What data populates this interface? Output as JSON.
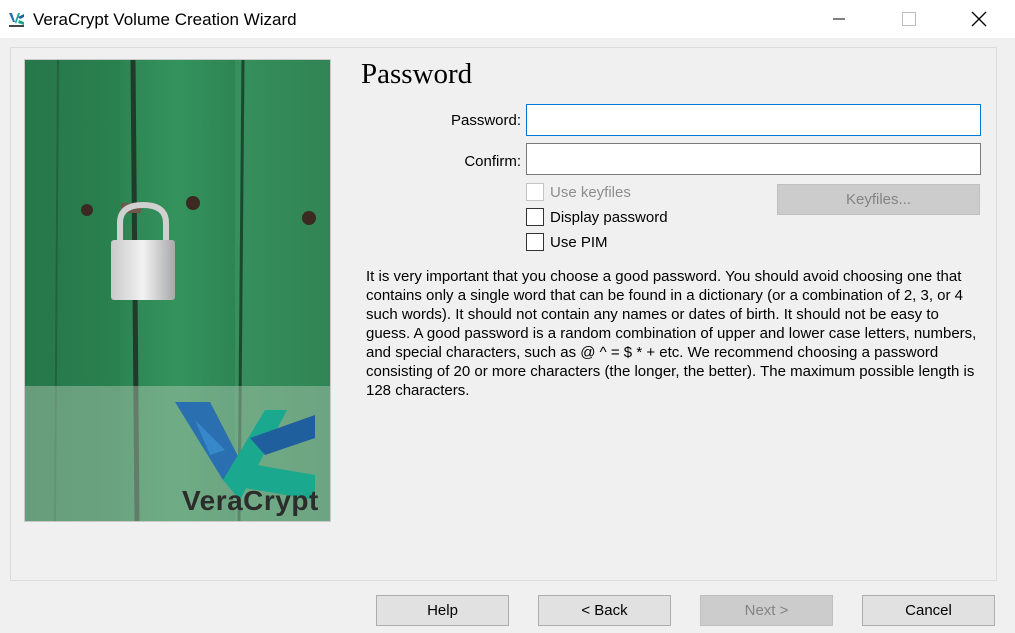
{
  "window": {
    "title": "VeraCrypt Volume Creation Wizard",
    "icon": "veracrypt-app-icon",
    "controls": [
      "minimize-icon",
      "maximize-icon",
      "close-icon"
    ]
  },
  "side_image": {
    "description_icon": "padlock-on-green-door-image",
    "logo_text": "VeraCrypt"
  },
  "page": {
    "title": "Password",
    "password_label": "Password:",
    "password_value": "",
    "confirm_label": "Confirm:",
    "confirm_value": "",
    "options": {
      "use_keyfiles": {
        "label": "Use keyfiles",
        "checked": false,
        "enabled": false
      },
      "display_password": {
        "label": "Display password",
        "checked": false,
        "enabled": true
      },
      "use_pim": {
        "label": "Use PIM",
        "checked": false,
        "enabled": true
      }
    },
    "keyfiles_button": {
      "label": "Keyfiles...",
      "enabled": false
    },
    "description": "It is very important that you choose a good password. You should avoid choosing one that contains only a single word that can be found in a dictionary (or a combination of 2, 3, or 4 such words). It should not contain any names or dates of birth. It should not be easy to guess. A good password is a random combination of upper and lower case letters, numbers, and special characters, such as @ ^ = $ * + etc. We recommend choosing a password consisting of 20 or more characters (the longer, the better). The maximum possible length is 128 characters."
  },
  "footer": {
    "help": {
      "label": "Help",
      "enabled": true
    },
    "back": {
      "label": "< Back",
      "enabled": true
    },
    "next": {
      "label": "Next >",
      "enabled": false
    },
    "cancel": {
      "label": "Cancel",
      "enabled": true
    }
  },
  "colors": {
    "focus_border": "#0078d7",
    "door_green": "#2f8a55",
    "logo_blue": "#2a6fb0",
    "logo_teal": "#1aa88f"
  }
}
